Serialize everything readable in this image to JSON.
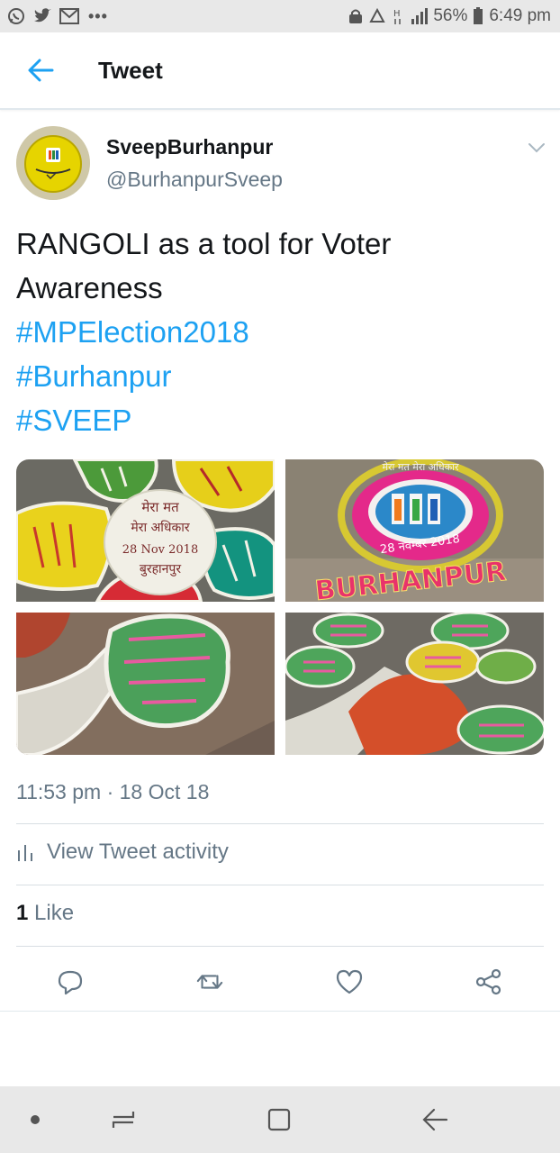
{
  "status_bar": {
    "battery": "56%",
    "time": "6:49 pm",
    "more": "•••"
  },
  "header": {
    "title": "Tweet"
  },
  "tweet": {
    "author_name": "SveepBurhanpur",
    "author_handle": "@BurhanpurSveep",
    "text": "RANGOLI as a tool for Voter Awareness",
    "hashtags": [
      "#MPElection2018",
      "#Burhanpur",
      "#SVEEP"
    ],
    "timestamp": "11:53 pm · 18 Oct 18",
    "activity_label": "View Tweet activity",
    "like_count": "1",
    "like_label": "Like"
  },
  "media_text": {
    "m1": [
      "मेरा मत",
      "मेरा अधिकार",
      "28 Nov 2018",
      "बुरहानपुर"
    ],
    "m2": [
      "मेरा मत मेरा अधिकार",
      "28 नवम्बर 2018",
      "BURHANPUR"
    ]
  },
  "colors": {
    "accent": "#1da1f2",
    "secondary_text": "#657786",
    "primary_text": "#14171a"
  },
  "icons": [
    "whatsapp-icon",
    "twitter-icon",
    "gmail-icon",
    "back-arrow-icon",
    "chevron-down-icon",
    "bar-chart-icon",
    "reply-icon",
    "retweet-icon",
    "like-icon",
    "share-icon"
  ]
}
